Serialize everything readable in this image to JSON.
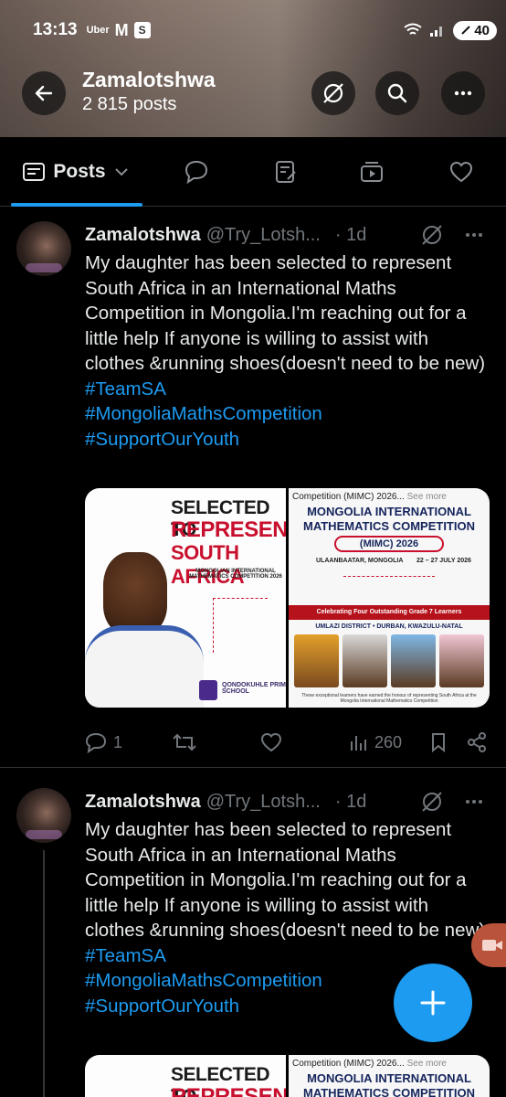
{
  "status_bar": {
    "time": "13:13",
    "app1": "Uber",
    "app2": "M",
    "app3": "S",
    "battery": "40"
  },
  "header": {
    "title": "Zamalotshwa",
    "posts_count": "2 815 posts"
  },
  "tabs": {
    "posts_label": "Posts"
  },
  "tweets": [
    {
      "display_name": "Zamalotshwa",
      "handle": "@Try_Lotsh...",
      "time": "· 1d",
      "text": "My daughter has been selected to represent South Africa in an International Maths Competition in Mongolia.I'm reaching out for a little help If anyone is willing to assist with clothes &running shoes(doesn't need to be new)",
      "hashtags": [
        "#TeamSA",
        "#MongoliaMathsCompetition",
        "#SupportOurYouth"
      ],
      "image_a": {
        "line1": "SELECTED TO",
        "line2": "REPRESENT",
        "line3": "SOUTH AFRICA",
        "sub": "MONGOLIAN INTERNATIONAL MATHEMATICS COMPETITION 2026",
        "school": "QONDOKUHLE PRIMARY SCHOOL"
      },
      "image_b": {
        "top": "Competition (MIMC) 2026...",
        "see_more": "See more",
        "title1": "MONGOLIA INTERNATIONAL",
        "title2": "MATHEMATICS COMPETITION",
        "pill": "(MIMC) 2026",
        "location": "ULAANBAATAR, MONGOLIA",
        "dates": "22 – 27 JULY 2026",
        "band": "Celebrating Four Outstanding Grade 7 Learners",
        "district": "UMLAZI DISTRICT • DURBAN, KWAZULU-NATAL",
        "footer": "These exceptional learners have earned the honour of representing South Africa at the Mongolia International Mathematics Competition"
      },
      "replies": "1",
      "views": "260"
    },
    {
      "display_name": "Zamalotshwa",
      "handle": "@Try_Lotsh...",
      "time": "· 1d",
      "text": "My daughter has been selected to represent South Africa in an International Maths Competition in Mongolia.I'm reaching out for a little help If anyone is willing to assist with clothes &running shoes(doesn't need to be new)",
      "hashtags": [
        "#TeamSA",
        "#MongoliaMathsCompetition",
        "#SupportOurYouth"
      ],
      "image_a": {
        "line1": "SELECTED TO",
        "line2": "REPRESENT"
      },
      "image_b": {
        "top": "Competition (MIMC) 2026...",
        "see_more": "See more",
        "title1": "MONGOLIA INTERNATIONAL",
        "title2": "MATHEMATICS COMPETITION"
      }
    }
  ],
  "colors": {
    "accent": "#1d9bf0",
    "background": "#000000",
    "muted": "#71767b"
  }
}
